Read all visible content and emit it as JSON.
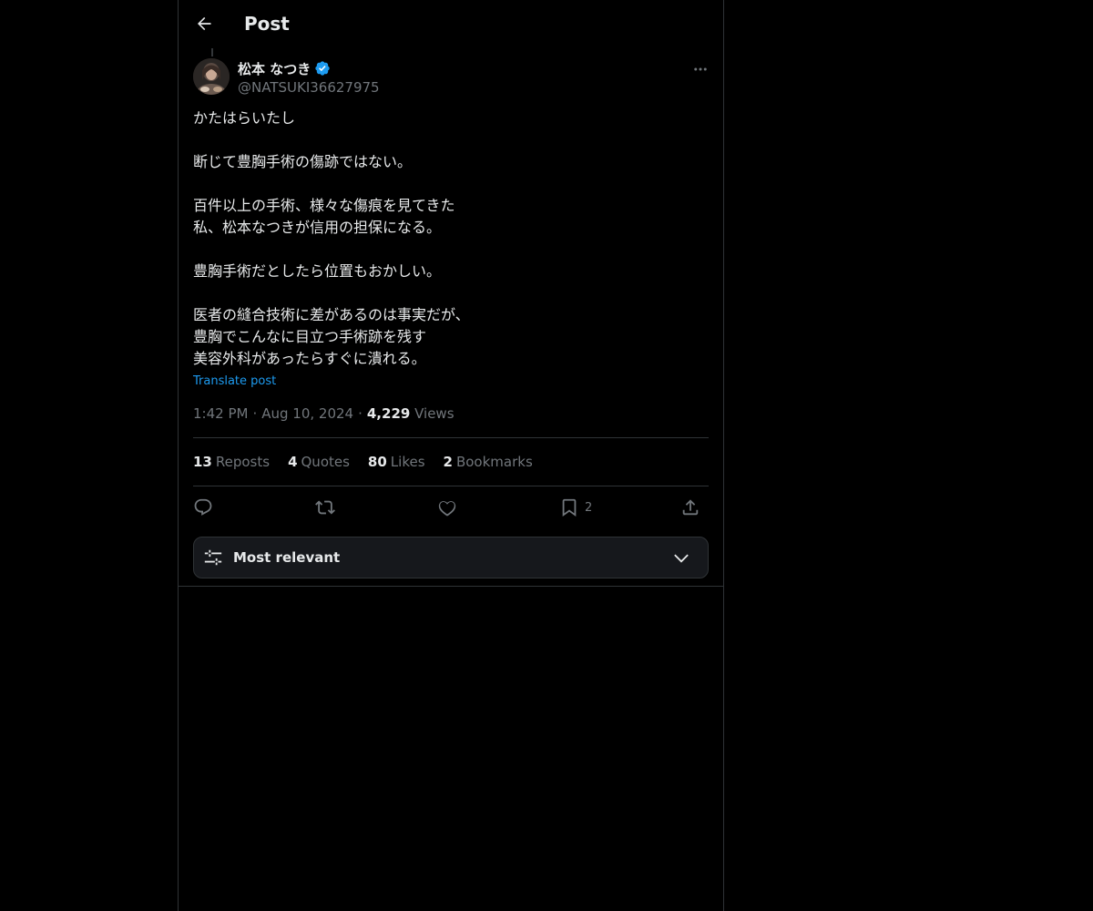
{
  "header": {
    "title": "Post",
    "back_icon": "arrow-left-icon"
  },
  "author": {
    "display_name": "松本 なつき",
    "handle": "@NATSUKI36627975",
    "verified": true,
    "verified_color": "#1d9bf0"
  },
  "post": {
    "text": "かたはらいたし\n\n断じて豊胸手術の傷跡ではない。\n\n百件以上の手術、様々な傷痕を見てきた\n私、松本なつきが信用の担保になる。\n\n豊胸手術だとしたら位置もおかしい。\n\n医者の縫合技術に差があるのは事実だが、\n豊胸でこんなに目立つ手術跡を残す\n美容外科があったらすぐに潰れる。",
    "translate_label": "Translate post",
    "time": "1:42 PM",
    "date": "Aug 10, 2024",
    "separator": "·",
    "views_count": "4,229",
    "views_label": "Views"
  },
  "stats": {
    "reposts_count": "13",
    "reposts_label": "Reposts",
    "quotes_count": "4",
    "quotes_label": "Quotes",
    "likes_count": "80",
    "likes_label": "Likes",
    "bookmarks_count": "2",
    "bookmarks_label": "Bookmarks"
  },
  "actions": {
    "reply_icon": "reply-icon",
    "repost_icon": "repost-icon",
    "like_icon": "heart-icon",
    "bookmark_icon": "bookmark-icon",
    "bookmark_count": "2",
    "share_icon": "share-icon"
  },
  "sort": {
    "label": "Most relevant",
    "icon": "sliders-icon",
    "chevron": "chevron-down-icon"
  },
  "colors": {
    "background": "#000000",
    "text": "#e7e9ea",
    "muted": "#71767b",
    "accent": "#1d9bf0",
    "border": "#2f3336"
  }
}
